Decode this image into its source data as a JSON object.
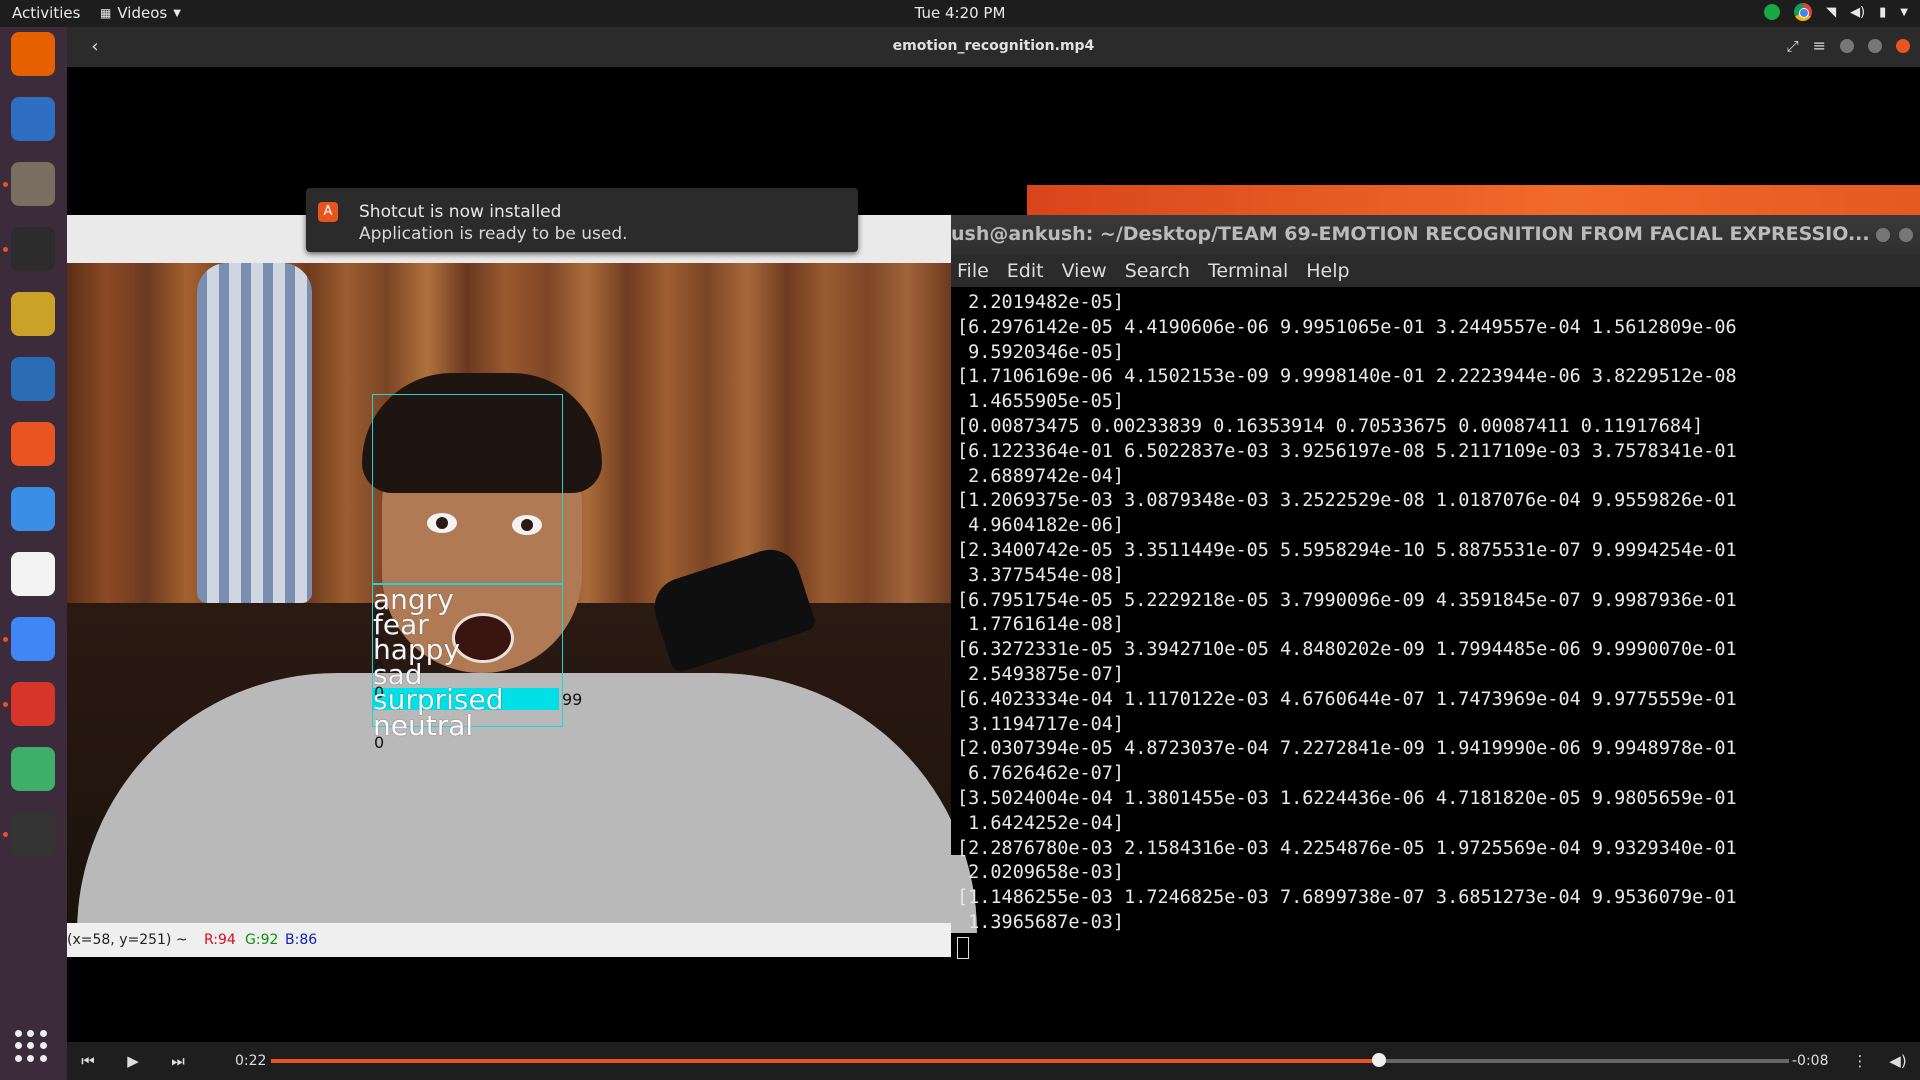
{
  "topbar": {
    "activities": "Activities",
    "app_menu": "Videos",
    "clock": "Tue  4:20 PM"
  },
  "dock": {
    "items": [
      {
        "name": "firefox-icon",
        "color": "#e66000",
        "running": false
      },
      {
        "name": "thunderbird-icon",
        "color": "#2e6fc4",
        "running": false
      },
      {
        "name": "files-icon",
        "color": "#7a6e60",
        "running": true
      },
      {
        "name": "terminal-icon",
        "color": "#2c2c2c",
        "running": true
      },
      {
        "name": "rhythmbox-icon",
        "color": "#c9a227",
        "running": false
      },
      {
        "name": "writer-icon",
        "color": "#2a6db5",
        "running": false
      },
      {
        "name": "software-center-icon",
        "color": "#e95420",
        "running": false
      },
      {
        "name": "help-icon",
        "color": "#3a8ee6",
        "running": false
      },
      {
        "name": "amazon-icon",
        "color": "#f3f3f3",
        "running": false
      },
      {
        "name": "chrome-icon",
        "color": "#4285f4",
        "running": true
      },
      {
        "name": "pdf-reader-icon",
        "color": "#d8352a",
        "running": true
      },
      {
        "name": "atom-icon",
        "color": "#3fae6b",
        "running": false
      },
      {
        "name": "videos-icon",
        "color": "#333333",
        "running": true
      }
    ]
  },
  "video_window": {
    "title": "emotion_recognition.mp4"
  },
  "notification": {
    "title": "Shotcut is now installed",
    "body": "Application is ready to be used."
  },
  "camera_window": {
    "labels": [
      "angry",
      "fear",
      "happy",
      "sad",
      "surprised",
      "neutral"
    ],
    "values": [
      "0",
      "0",
      "0",
      "0",
      "99",
      "0"
    ],
    "highlight": "surprised",
    "status": {
      "coords": "(x=58, y=251) ~",
      "r": "R:94",
      "g": "G:92",
      "b": "B:86"
    }
  },
  "terminal": {
    "title": "ush@ankush: ~/Desktop/TEAM 69-EMOTION RECOGNITION FROM FACIAL EXPRESSIO...",
    "menu": [
      "File",
      "Edit",
      "View",
      "Search",
      "Terminal",
      "Help"
    ],
    "lines": [
      " 2.2019482e-05]",
      "[6.2976142e-05 4.4190606e-06 9.9951065e-01 3.2449557e-04 1.5612809e-06",
      " 9.5920346e-05]",
      "[1.7106169e-06 4.1502153e-09 9.9998140e-01 2.2223944e-06 3.8229512e-08",
      " 1.4655905e-05]",
      "[0.00873475 0.00233839 0.16353914 0.70533675 0.00087411 0.11917684]",
      "[6.1223364e-01 6.5022837e-03 3.9256197e-08 5.2117109e-03 3.7578341e-01",
      " 2.6889742e-04]",
      "[1.2069375e-03 3.0879348e-03 3.2522529e-08 1.0187076e-04 9.9559826e-01",
      " 4.9604182e-06]",
      "[2.3400742e-05 3.3511449e-05 5.5958294e-10 5.8875531e-07 9.9994254e-01",
      " 3.3775454e-08]",
      "[6.7951754e-05 5.2229218e-05 3.7990096e-09 4.3591845e-07 9.9987936e-01",
      " 1.7761614e-08]",
      "[6.3272331e-05 3.3942710e-05 4.8480202e-09 1.7994485e-06 9.9990070e-01",
      " 2.5493875e-07]",
      "[6.4023334e-04 1.1170122e-03 4.6760644e-07 1.7473969e-04 9.9775559e-01",
      " 3.1194717e-04]",
      "[2.0307394e-05 4.8723037e-04 7.2272841e-09 1.9419990e-06 9.9948978e-01",
      " 6.7626462e-07]",
      "[3.5024004e-04 1.3801455e-03 1.6224436e-06 4.7181820e-05 9.9805659e-01",
      " 1.6424252e-04]",
      "[2.2876780e-03 2.1584316e-03 4.2254876e-05 1.9725569e-04 9.9329340e-01",
      " 2.0209658e-03]",
      "[1.1486255e-03 1.7246825e-03 7.6899738e-07 3.6851273e-04 9.9536079e-01",
      " 1.3965687e-03]"
    ]
  },
  "player": {
    "elapsed": "0:22",
    "remaining": "-0:08",
    "progress": 0.73
  },
  "colors": {
    "accent": "#e95420",
    "detect_box": "#22d3d8",
    "dock_bg": "#3b2b3b"
  }
}
